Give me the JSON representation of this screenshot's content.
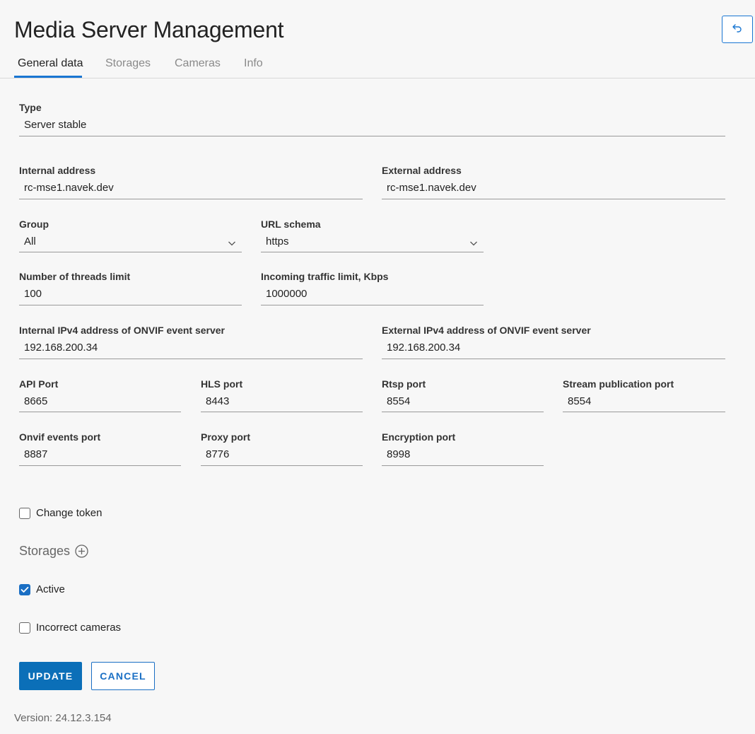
{
  "header": {
    "title": "Media Server Management"
  },
  "tabs": [
    {
      "label": "General data",
      "active": true
    },
    {
      "label": "Storages",
      "active": false
    },
    {
      "label": "Cameras",
      "active": false
    },
    {
      "label": "Info",
      "active": false
    }
  ],
  "form": {
    "type": {
      "label": "Type",
      "value": "Server stable"
    },
    "internal_address": {
      "label": "Internal address",
      "value": "rc-mse1.navek.dev"
    },
    "external_address": {
      "label": "External address",
      "value": "rc-mse1.navek.dev"
    },
    "group": {
      "label": "Group",
      "value": "All"
    },
    "url_schema": {
      "label": "URL schema",
      "value": "https"
    },
    "threads_limit": {
      "label": "Number of threads limit",
      "value": "100"
    },
    "traffic_limit": {
      "label": "Incoming traffic limit, Kbps",
      "value": "1000000"
    },
    "internal_onvif": {
      "label": "Internal IPv4 address of ONVIF event server",
      "value": "192.168.200.34"
    },
    "external_onvif": {
      "label": "External IPv4 address of ONVIF event server",
      "value": "192.168.200.34"
    },
    "api_port": {
      "label": "API Port",
      "value": "8665"
    },
    "hls_port": {
      "label": "HLS port",
      "value": "8443"
    },
    "rtsp_port": {
      "label": "Rtsp port",
      "value": "8554"
    },
    "stream_publication_port": {
      "label": "Stream publication port",
      "value": "8554"
    },
    "onvif_events_port": {
      "label": "Onvif events port",
      "value": "8887"
    },
    "proxy_port": {
      "label": "Proxy port",
      "value": "8776"
    },
    "encryption_port": {
      "label": "Encryption port",
      "value": "8998"
    }
  },
  "checkboxes": {
    "change_token": {
      "label": "Change token",
      "checked": false
    },
    "active": {
      "label": "Active",
      "checked": true
    },
    "incorrect_cameras": {
      "label": "Incorrect cameras",
      "checked": false
    }
  },
  "storages": {
    "title": "Storages"
  },
  "buttons": {
    "update": "UPDATE",
    "cancel": "CANCEL"
  },
  "footer": {
    "version": "Version: 24.12.3.154"
  },
  "colors": {
    "accent": "#1976d2",
    "primary_button": "#0b6fb8"
  },
  "icons": {
    "back": "undo-arrow-icon",
    "select": "chevron-down-icon",
    "add": "plus-circle-icon",
    "check": "checkmark-icon"
  }
}
